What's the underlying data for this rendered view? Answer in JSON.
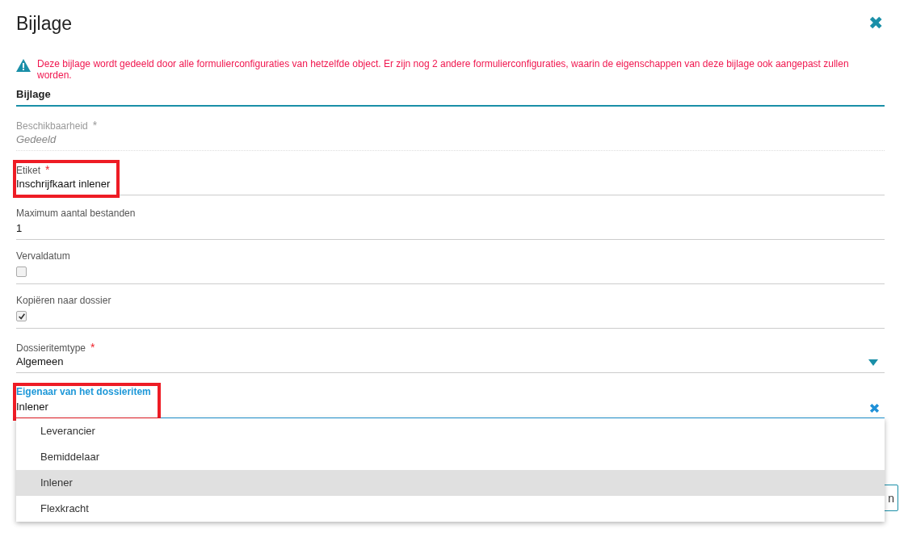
{
  "dialog": {
    "title": "Bijlage",
    "close_icon": "✖"
  },
  "warning": "Deze bijlage wordt gedeeld door alle formulierconfiguraties van hetzelfde object. Er zijn nog 2 andere formulierconfiguraties, waarin de eigenschappen van deze bijlage ook aangepast zullen worden.",
  "section": "Bijlage",
  "required_mark": "*",
  "fields": [
    {
      "kind": "readonly",
      "label": "Beschikbaarheid",
      "required": true,
      "value": "Gedeeld",
      "highlighted": false,
      "focused": false
    },
    {
      "kind": "text",
      "label": "Etiket",
      "required": true,
      "value": "Inschrijfkaart inlener",
      "highlighted": true,
      "focused": false
    },
    {
      "kind": "text",
      "label": "Maximum aantal bestanden",
      "required": false,
      "value": "1",
      "highlighted": false,
      "focused": false
    },
    {
      "kind": "checkbox",
      "label": "Vervaldatum",
      "required": false,
      "checked": false,
      "highlighted": false,
      "focused": false
    },
    {
      "kind": "checkbox",
      "label": "Kopiëren naar dossier",
      "required": false,
      "checked": true,
      "highlighted": false,
      "focused": false
    },
    {
      "kind": "select",
      "label": "Dossieritemtype",
      "required": true,
      "value": "Algemeen",
      "highlighted": false,
      "focused": false
    },
    {
      "kind": "combobox",
      "label": "Eigenaar van het dossieritem",
      "required": false,
      "value": "Inlener",
      "highlighted": true,
      "focused": true
    }
  ],
  "dropdown_options": [
    {
      "label": "Leverancier",
      "selected": false
    },
    {
      "label": "Bemiddelaar",
      "selected": false
    },
    {
      "label": "Inlener",
      "selected": true
    },
    {
      "label": "Flexkracht",
      "selected": false
    }
  ],
  "hidden_button": "n"
}
